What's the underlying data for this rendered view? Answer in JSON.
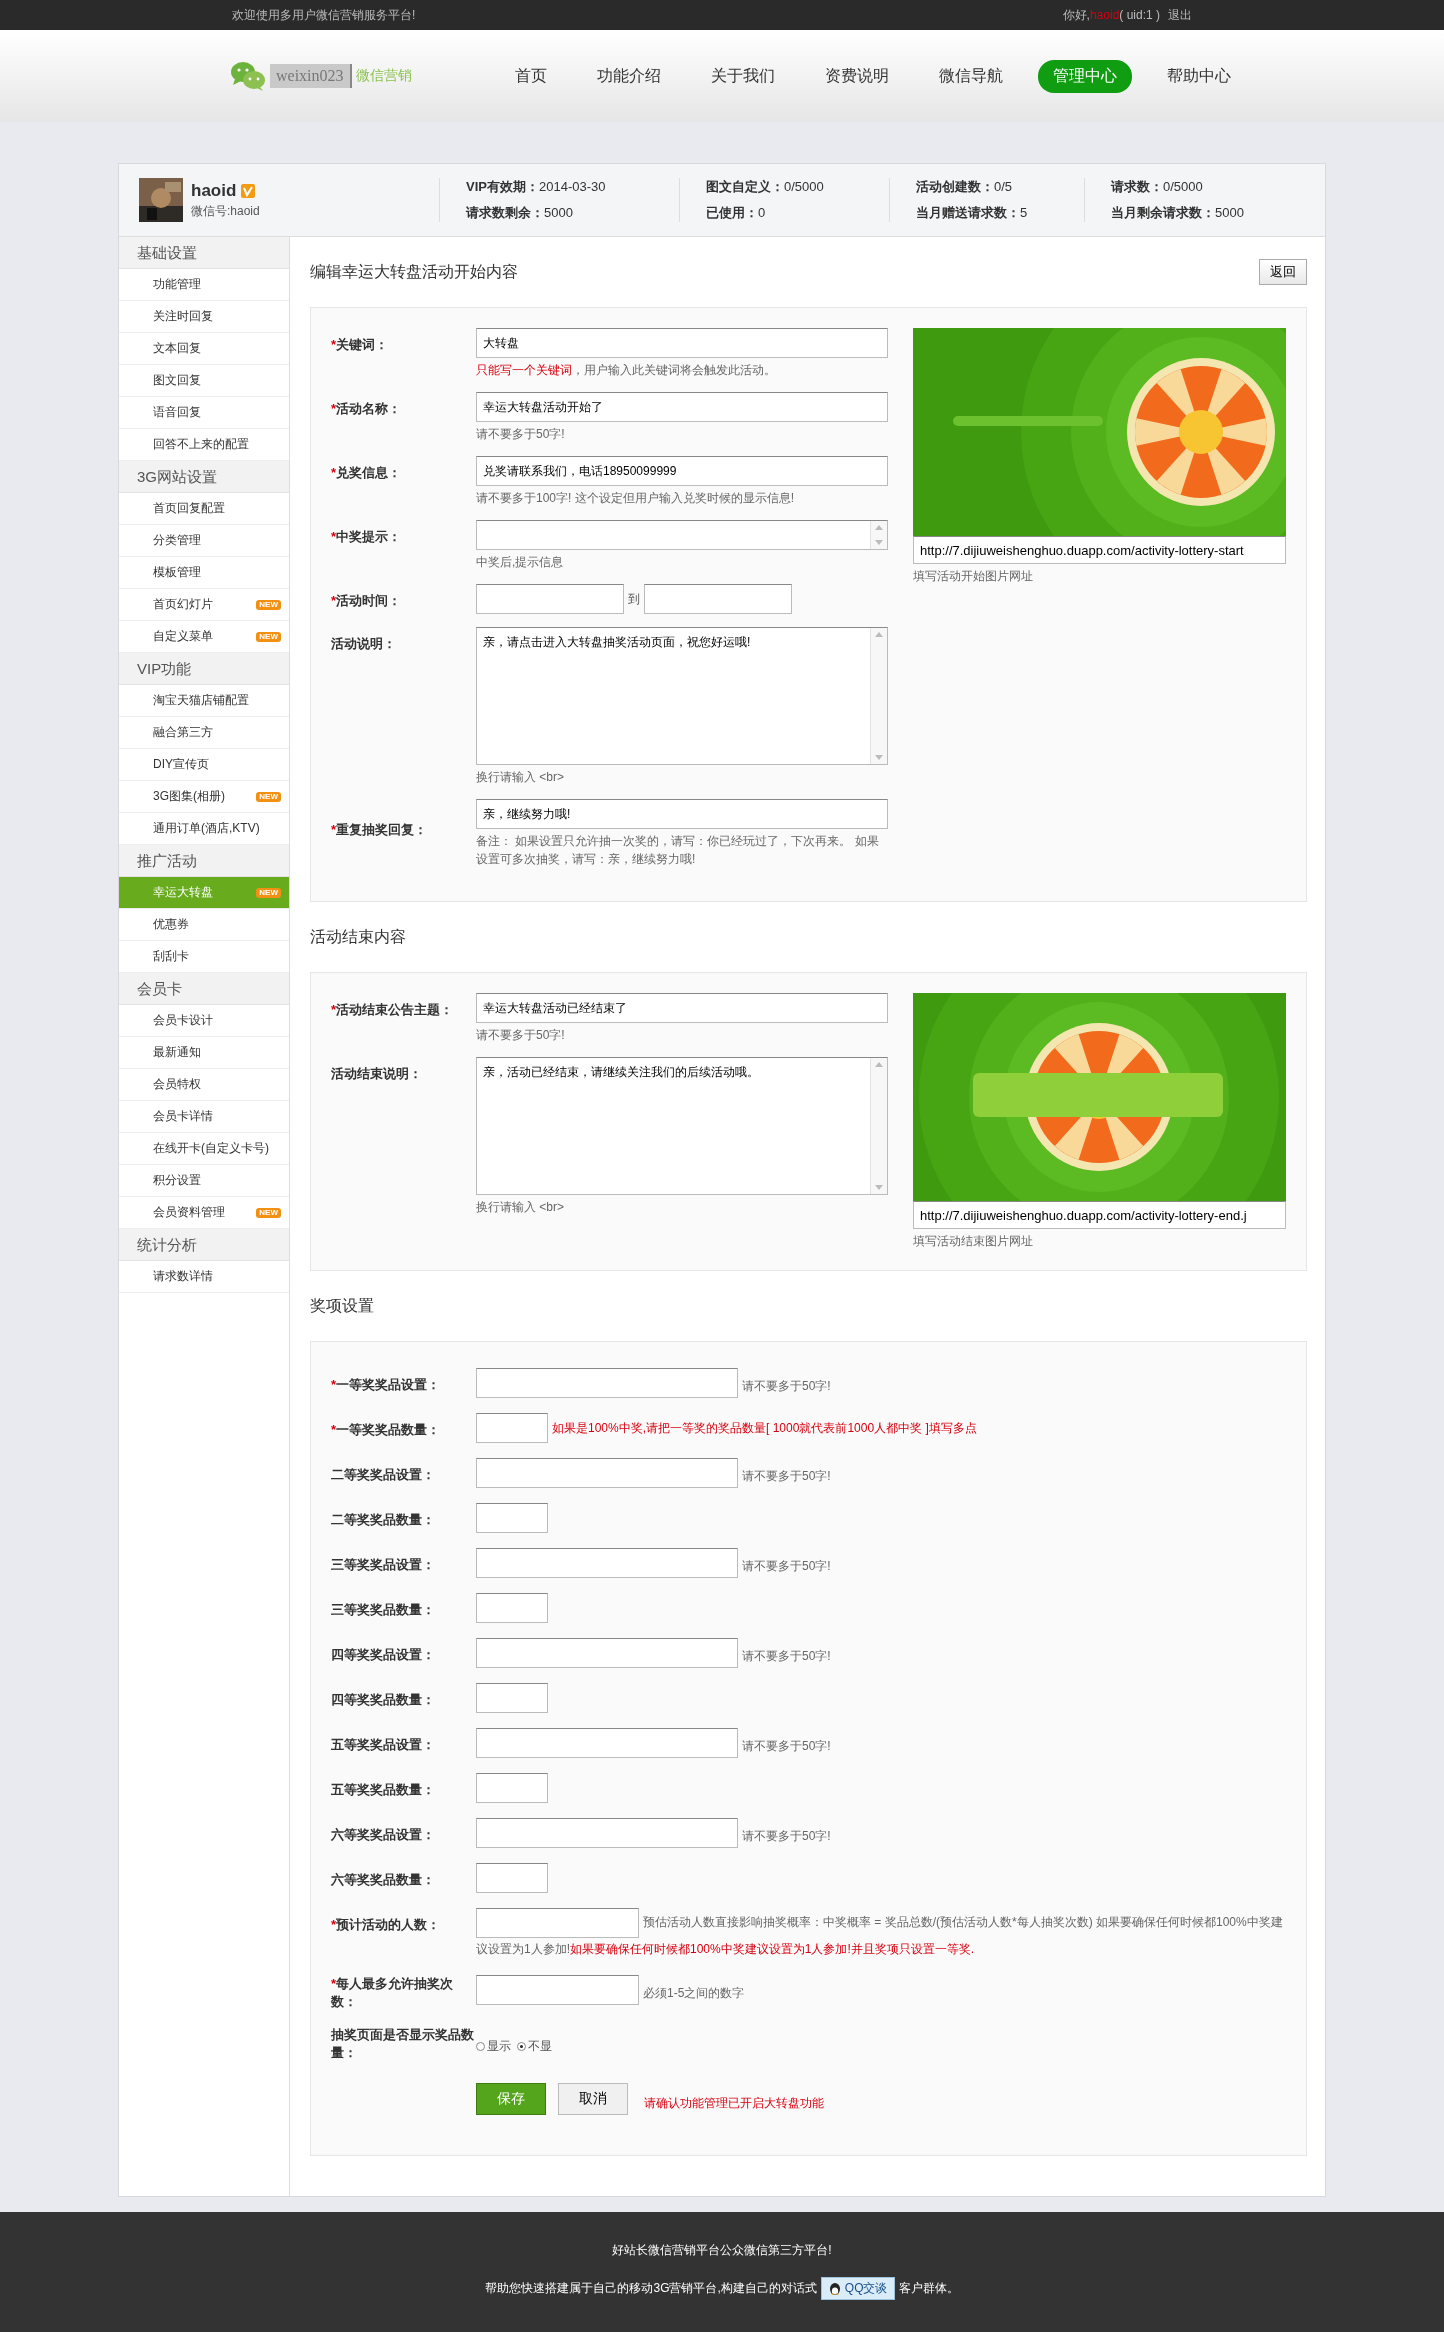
{
  "top_bar": {
    "welcome": "欢迎使用多用户微信营销服务平台!",
    "greeting": "你好,",
    "username": "haoid",
    "uid": "( uid:1 )",
    "logout": "退出"
  },
  "header": {
    "logo_text": "weixin023",
    "logo_sub": "微信营销",
    "nav": [
      {
        "label": "首页",
        "selected": false
      },
      {
        "label": "功能介绍",
        "selected": false
      },
      {
        "label": "关于我们",
        "selected": false
      },
      {
        "label": "资费说明",
        "selected": false
      },
      {
        "label": "微信导航",
        "selected": false
      },
      {
        "label": "管理中心",
        "selected": true
      },
      {
        "label": "帮助中心",
        "selected": false
      }
    ]
  },
  "profile": {
    "name": "haoid",
    "wechat_id": "微信号:haoid",
    "stats": [
      [
        {
          "label": "VIP有效期：",
          "value": "2014-03-30"
        },
        {
          "label": "请求数剩余：",
          "value": "5000"
        }
      ],
      [
        {
          "label": "图文自定义：",
          "value": "0/5000"
        },
        {
          "label": "已使用：",
          "value": "0"
        }
      ],
      [
        {
          "label": "活动创建数：",
          "value": "0/5"
        },
        {
          "label": "当月赠送请求数：",
          "value": "5"
        }
      ],
      [
        {
          "label": "请求数：",
          "value": "0/5000"
        },
        {
          "label": "当月剩余请求数：",
          "value": "5000"
        }
      ]
    ]
  },
  "sidebar": [
    {
      "title": "基础设置",
      "items": [
        {
          "label": "功能管理",
          "selected": false
        },
        {
          "label": "关注时回复",
          "selected": false
        },
        {
          "label": "文本回复",
          "selected": false
        },
        {
          "label": "图文回复",
          "selected": false
        },
        {
          "label": "语音回复",
          "selected": false
        },
        {
          "label": "回答不上来的配置",
          "selected": false
        }
      ]
    },
    {
      "title": "3G网站设置",
      "items": [
        {
          "label": "首页回复配置",
          "selected": false
        },
        {
          "label": "分类管理",
          "selected": false
        },
        {
          "label": "模板管理",
          "selected": false
        },
        {
          "label": "首页幻灯片",
          "selected": false,
          "badge": "NEW"
        },
        {
          "label": "自定义菜单",
          "selected": false,
          "badge": "NEW"
        }
      ]
    },
    {
      "title": "VIP功能",
      "items": [
        {
          "label": "淘宝天猫店铺配置",
          "selected": false
        },
        {
          "label": "融合第三方",
          "selected": false
        },
        {
          "label": "DIY宣传页",
          "selected": false
        },
        {
          "label": "3G图集(相册)",
          "selected": false,
          "badge": "NEW"
        },
        {
          "label": "通用订单(酒店,KTV)",
          "selected": false
        }
      ]
    },
    {
      "title": "推广活动",
      "items": [
        {
          "label": "幸运大转盘",
          "selected": true,
          "badge": "NEW"
        },
        {
          "label": "优惠券",
          "selected": false
        },
        {
          "label": "刮刮卡",
          "selected": false
        }
      ]
    },
    {
      "title": "会员卡",
      "items": [
        {
          "label": "会员卡设计",
          "selected": false
        },
        {
          "label": "最新通知",
          "selected": false
        },
        {
          "label": "会员特权",
          "selected": false
        },
        {
          "label": "会员卡详情",
          "selected": false
        },
        {
          "label": "在线开卡(自定义卡号)",
          "selected": false
        },
        {
          "label": "积分设置",
          "selected": false
        },
        {
          "label": "会员资料管理",
          "selected": false,
          "badge": "NEW"
        }
      ]
    },
    {
      "title": "统计分析",
      "items": [
        {
          "label": "请求数详情",
          "selected": false
        }
      ]
    }
  ],
  "start_section": {
    "title": "编辑幸运大转盘活动开始内容",
    "back_button": "返回",
    "fields": [
      {
        "kind": "text",
        "required_mark": "*",
        "label": "关键词：",
        "value": "大转盘",
        "hint_parts": [
          {
            "text": "只能写一个关键词",
            "alert": true
          },
          {
            "text": "，用户输入此关键词将会触发此活动。",
            "alert": false
          }
        ]
      },
      {
        "kind": "text",
        "required_mark": "*",
        "label": "活动名称：",
        "value": "幸运大转盘活动开始了",
        "hint_parts": [
          {
            "text": "请不要多于50字!",
            "alert": false
          }
        ]
      },
      {
        "kind": "text",
        "required_mark": "*",
        "label": "兑奖信息：",
        "value": "兑奖请联系我们，电话18950099999",
        "hint_parts": [
          {
            "text": "请不要多于100字! 这个设定但用户输入兑奖时候的显示信息!",
            "alert": false
          }
        ]
      },
      {
        "kind": "small_textarea",
        "required_mark": "*",
        "label": "中奖提示：",
        "hint_parts": [
          {
            "text": "中奖后,提示信息",
            "alert": false
          }
        ]
      },
      {
        "kind": "range",
        "required_mark": "*",
        "label": "活动时间：",
        "separator": "到"
      },
      {
        "kind": "textarea",
        "label": "活动说明：",
        "value": "亲，请点击进入大转盘抽奖活动页面，祝您好运哦!",
        "hint_parts": [
          {
            "text": "换行请输入 <br>",
            "alert": false
          }
        ]
      },
      {
        "kind": "text",
        "required_mark": "*",
        "label": "重复抽奖回复：",
        "value": "亲，继续努力哦!",
        "hint_parts": [
          {
            "text": "备注： 如果设置只允许抽一次奖的，请写：你已经玩过了，下次再来。 如果设置可多次抽奖，请写：亲，继续努力哦!",
            "alert": false
          }
        ]
      }
    ],
    "image": {
      "kind": "picture",
      "url": "http://7.dijiuweishenghuo.duapp.com/activity-lottery-start",
      "hint": "填写活动开始图片网址"
    }
  },
  "end_section": {
    "title": "活动结束内容",
    "fields": [
      {
        "kind": "text",
        "required_mark": "*",
        "label": "活动结束公告主题：",
        "value": "幸运大转盘活动已经结束了",
        "hint_parts": [
          {
            "text": "请不要多于50字!",
            "alert": false
          }
        ]
      },
      {
        "kind": "textarea",
        "label": "活动结束说明：",
        "value": "亲，活动已经结束，请继续关注我们的后续活动哦。",
        "hint_parts": [
          {
            "text": "换行请输入 <br>",
            "alert": false
          }
        ]
      }
    ],
    "image": {
      "kind": "picture",
      "url": "http://7.dijiuweishenghuo.duapp.com/activity-lottery-end.j",
      "hint": "填写活动结束图片网址"
    }
  },
  "prize_section": {
    "title": "奖项设置",
    "fields": [
      {
        "kind": "name",
        "required_mark": "*",
        "label": "一等奖奖品设置：",
        "hint_parts": [
          {
            "text": "请不要多于50字!",
            "alert": false
          }
        ]
      },
      {
        "kind": "count",
        "required_mark": "*",
        "label": "一等奖奖品数量：",
        "hint_parts": [
          {
            "text": "如果是100%中奖,请把一等奖的奖品数量[ 1000就代表前1000人都中奖 ]填写多点",
            "alert": true
          }
        ]
      },
      {
        "kind": "name",
        "label": "二等奖奖品设置：",
        "hint_parts": [
          {
            "text": "请不要多于50字!",
            "alert": false
          }
        ]
      },
      {
        "kind": "count",
        "label": "二等奖奖品数量："
      },
      {
        "kind": "name",
        "label": "三等奖奖品设置：",
        "hint_parts": [
          {
            "text": "请不要多于50字!",
            "alert": false
          }
        ]
      },
      {
        "kind": "count",
        "label": "三等奖奖品数量："
      },
      {
        "kind": "name",
        "label": "四等奖奖品设置：",
        "hint_parts": [
          {
            "text": "请不要多于50字!",
            "alert": false
          }
        ]
      },
      {
        "kind": "count",
        "label": "四等奖奖品数量："
      },
      {
        "kind": "name",
        "label": "五等奖奖品设置：",
        "hint_parts": [
          {
            "text": "请不要多于50字!",
            "alert": false
          }
        ]
      },
      {
        "kind": "count",
        "label": "五等奖奖品数量："
      },
      {
        "kind": "name",
        "label": "六等奖奖品设置：",
        "hint_parts": [
          {
            "text": "请不要多于50字!",
            "alert": false
          }
        ]
      },
      {
        "kind": "count",
        "label": "六等奖奖品数量："
      },
      {
        "kind": "estimate",
        "required_mark": "*",
        "label": "预计活动的人数：",
        "hint_parts": [
          {
            "text": "预估活动人数直接影响抽奖概率：中奖概率 = 奖品总数/(预估活动人数*每人抽奖次数) 如果要确保任何时候都100%中奖建议设置为1人参加!",
            "alert": false
          },
          {
            "text": "如果要确保任何时候都100%中奖建议设置为1人参加!并且奖项只设置一等奖.",
            "alert": true
          }
        ]
      },
      {
        "kind": "medium",
        "required_mark": "*",
        "label": "每人最多允许抽奖次数：",
        "hint_parts": [
          {
            "text": "必须1-5之间的数字",
            "alert": false
          }
        ]
      },
      {
        "kind": "radio",
        "label": "抽奖页面是否显示奖品数量：",
        "options": [
          {
            "label": "显示",
            "selected": false
          },
          {
            "label": "不显",
            "selected": true
          }
        ]
      }
    ],
    "save_button": "保存",
    "cancel_button": "取消",
    "note": "请确认功能管理已开启大转盘功能"
  },
  "footer": {
    "line_1": "好站长微信营销平台公众微信第三方平台!",
    "line_2_start": "帮助您快速搭建属于自己的移动3G营销平台,构建自己的对话式",
    "chat_button": "QQ交谈",
    "line_2_end": "客户群体。"
  }
}
